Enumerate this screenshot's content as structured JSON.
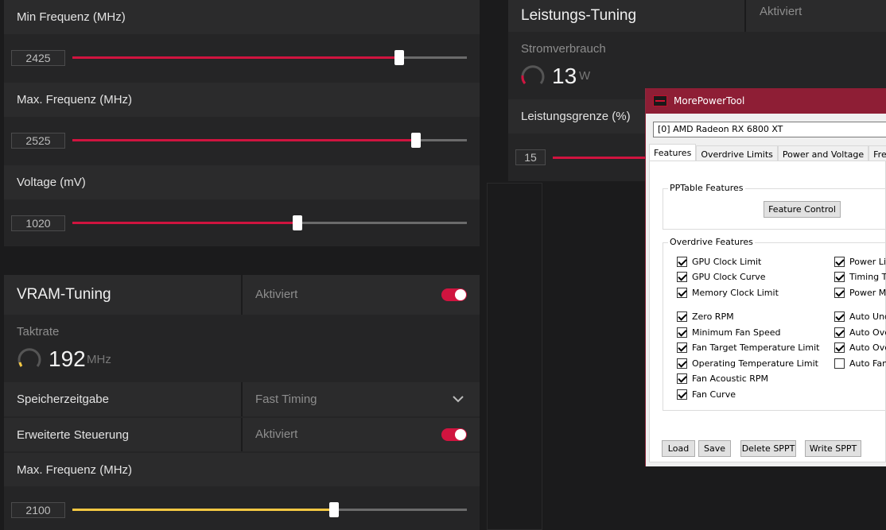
{
  "gpu_panel": {
    "min_freq": {
      "label": "Min Frequenz (MHz)",
      "value": "2425",
      "fraction": 0.83
    },
    "max_freq": {
      "label": "Max. Frequenz (MHz)",
      "value": "2525",
      "fraction": 0.87
    },
    "voltage": {
      "label": "Voltage (mV)",
      "value": "1020",
      "fraction": 0.57
    }
  },
  "vram": {
    "title": "VRAM-Tuning",
    "status": "Aktiviert",
    "clock_label": "Taktrate",
    "clock_value": "192",
    "clock_unit": "MHz",
    "timing_label": "Speicherzeitgabe",
    "timing_value": "Fast Timing",
    "advanced_label": "Erweiterte Steuerung",
    "advanced_status": "Aktiviert",
    "max_freq": {
      "label": "Max. Frequenz (MHz)",
      "value": "2100",
      "fraction": 0.66
    }
  },
  "power": {
    "title": "Leistungs-Tuning",
    "status": "Aktiviert",
    "consumption_label": "Stromverbrauch",
    "consumption_value": "13",
    "consumption_unit": "W",
    "limit_label": "Leistungsgrenze (%)",
    "limit_value": "15"
  },
  "mpt": {
    "title": "MorePowerTool",
    "device": "[0] AMD Radeon RX 6800 XT",
    "tabs": [
      "Features",
      "Overdrive Limits",
      "Power and Voltage",
      "Frequency"
    ],
    "pptable_label": "PPTable Features",
    "feature_control": "Feature Control",
    "overdrive_label": "Overdrive Features",
    "left_col": [
      {
        "label": "GPU Clock Limit",
        "checked": true
      },
      {
        "label": "GPU Clock Curve",
        "checked": true
      },
      {
        "label": "Memory Clock Limit",
        "checked": true
      },
      {
        "label": "Zero RPM",
        "checked": true
      },
      {
        "label": "Minimum Fan Speed",
        "checked": true
      },
      {
        "label": "Fan Target Temperature Limit",
        "checked": true
      },
      {
        "label": "Operating Temperature Limit",
        "checked": true
      },
      {
        "label": "Fan Acoustic RPM",
        "checked": true
      },
      {
        "label": "Fan Curve",
        "checked": true
      }
    ],
    "right_col": [
      {
        "label": "Power Lim",
        "checked": true
      },
      {
        "label": "Timing Tun",
        "checked": true
      },
      {
        "label": "Power Mo",
        "checked": true
      },
      {
        "label": "Auto Unde",
        "checked": true
      },
      {
        "label": "Auto Over",
        "checked": true
      },
      {
        "label": "Auto Over",
        "checked": true
      },
      {
        "label": "Auto Fan",
        "checked": false
      }
    ],
    "buttons": {
      "load": "Load",
      "save": "Save",
      "delete": "Delete SPPT",
      "write": "Write SPPT"
    }
  },
  "colors": {
    "accent": "#d0143f",
    "vram_slider": "#f5c842",
    "mpt_titlebar": "#8e1e35"
  }
}
